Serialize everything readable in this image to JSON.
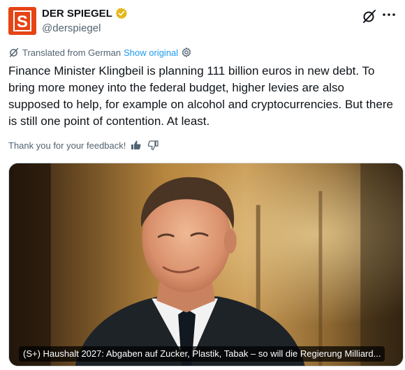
{
  "tweet": {
    "display_name": "DER SPIEGEL",
    "handle": "@derspiegel",
    "avatar_letter": "S",
    "verified_icon": "gold-verified-badge-icon",
    "translation": {
      "label": "Translated from German",
      "show_original": "Show original"
    },
    "text": "Finance Minister Klingbeil is planning 111 billion euros in new debt. To bring more money into the federal budget, higher levies are also supposed to help, for example on alcohol and cryptocurrencies. But there is still one point of contention. At least.",
    "feedback": {
      "label": "Thank you for your feedback!"
    },
    "card": {
      "title": "(S+) Haushalt 2027: Abgaben auf Zucker, Plastik, Tabak – so will die Regierung Milliard..."
    }
  },
  "colors": {
    "brand": "#e64415",
    "link": "#1d9bf0",
    "secondary_text": "#536471",
    "verified_gold": "#e2b719"
  }
}
